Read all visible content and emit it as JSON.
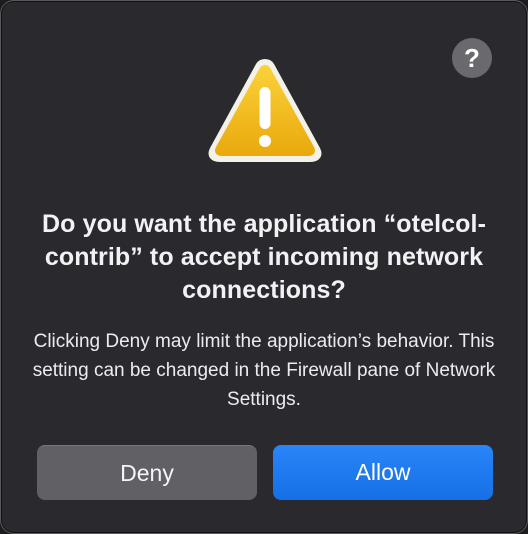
{
  "dialog": {
    "help_label": "?",
    "icon": "warning-triangle-icon",
    "title": "Do you want the application “otelcol-contrib” to accept incoming network connections?",
    "message": "Clicking Deny may limit the application’s behavior. This setting can be changed in the Firewall pane of Network Settings.",
    "buttons": {
      "deny": "Deny",
      "allow": "Allow"
    }
  },
  "colors": {
    "background": "#2a2a2e",
    "accent": "#1b7bf5",
    "secondary_button": "#606065",
    "warning_yellow": "#f5c518"
  }
}
